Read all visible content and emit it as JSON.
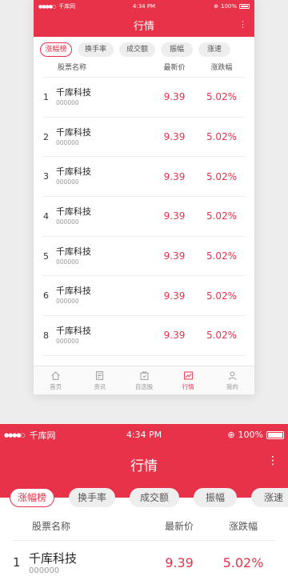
{
  "status": {
    "carrier": "千库网",
    "time": "4:34 PM",
    "battery": "100%"
  },
  "nav": {
    "title": "行情",
    "more_icon": "more-vertical-icon"
  },
  "tabs": [
    {
      "label": "涨幅榜",
      "active": true
    },
    {
      "label": "换手率",
      "active": false
    },
    {
      "label": "成交额",
      "active": false
    },
    {
      "label": "振幅",
      "active": false
    },
    {
      "label": "涨速",
      "active": false
    }
  ],
  "table": {
    "headers": {
      "name": "股票名称",
      "price": "最新价",
      "change": "涨跌幅"
    },
    "rows": [
      {
        "idx": "1",
        "name": "千库科技",
        "code": "000000",
        "price": "9.39",
        "change": "5.02%"
      },
      {
        "idx": "2",
        "name": "千库科技",
        "code": "000000",
        "price": "9.39",
        "change": "5.02%"
      },
      {
        "idx": "3",
        "name": "千库科技",
        "code": "000000",
        "price": "9.39",
        "change": "5.02%"
      },
      {
        "idx": "4",
        "name": "千库科技",
        "code": "000000",
        "price": "9.39",
        "change": "5.02%"
      },
      {
        "idx": "5",
        "name": "千库科技",
        "code": "000000",
        "price": "9.39",
        "change": "5.02%"
      },
      {
        "idx": "6",
        "name": "千库科技",
        "code": "000000",
        "price": "9.39",
        "change": "5.02%"
      },
      {
        "idx": "8",
        "name": "千库科技",
        "code": "000000",
        "price": "9.39",
        "change": "5.02%"
      }
    ]
  },
  "bottom_nav": [
    {
      "label": "首页",
      "icon": "home-icon",
      "active": false
    },
    {
      "label": "资讯",
      "icon": "news-icon",
      "active": false
    },
    {
      "label": "自选股",
      "icon": "watchlist-icon",
      "active": false
    },
    {
      "label": "行情",
      "icon": "chart-icon",
      "active": true
    },
    {
      "label": "我的",
      "icon": "user-icon",
      "active": false
    }
  ],
  "colors": {
    "accent": "#e8324a",
    "background": "#ededed"
  }
}
